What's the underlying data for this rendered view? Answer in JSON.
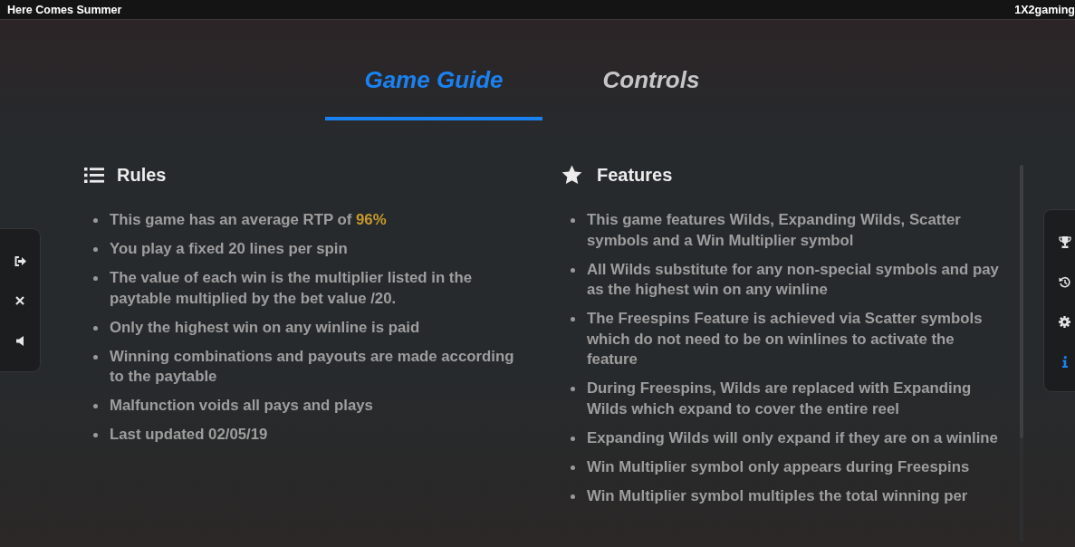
{
  "window": {
    "title": "Here Comes Summer",
    "brand": "1X2gaming"
  },
  "tabs": [
    {
      "label": "Game Guide",
      "selected": true
    },
    {
      "label": "Controls",
      "selected": false
    }
  ],
  "sections": [
    {
      "kind": "rules",
      "heading": "Rules",
      "items": [
        {
          "text": "This game has an average RTP of",
          "value": "96%"
        },
        {
          "text": "You play a fixed 20 lines per spin"
        },
        {
          "text": "The value of each win is the multiplier listed in the paytable multiplied by the bet value /20."
        },
        {
          "text": "Only the highest win on any winline is paid"
        },
        {
          "text": "Winning combinations and payouts are made according to the paytable"
        },
        {
          "text": "Malfunction voids all pays and plays"
        },
        {
          "text": "Last updated 02/05/19"
        }
      ]
    },
    {
      "kind": "features",
      "heading": "Features",
      "items": [
        {
          "text": "This game features Wilds, Expanding Wilds, Scatter symbols and a Win Multiplier symbol"
        },
        {
          "text": "All Wilds substitute for any non-special symbols and pay as the highest win on any winline"
        },
        {
          "text": "The Freespins Feature is achieved via Scatter symbols which do not need to be on winlines to activate the feature"
        },
        {
          "text": "During Freespins, Wilds are replaced with Expanding Wilds which expand to cover the entire reel"
        },
        {
          "text": "Expanding Wilds will only expand if they are on a winline"
        },
        {
          "text": "Win Multiplier symbol only appears during Freespins"
        },
        {
          "text": "Win Multiplier symbol multiples the total winning per"
        }
      ]
    }
  ],
  "left_toolbar": [
    {
      "kind": "exit"
    },
    {
      "kind": "close"
    },
    {
      "kind": "sound"
    }
  ],
  "right_toolbar": [
    {
      "kind": "trophy",
      "selected": false
    },
    {
      "kind": "history",
      "selected": false
    },
    {
      "kind": "settings",
      "selected": false
    },
    {
      "kind": "info",
      "selected": true
    }
  ]
}
